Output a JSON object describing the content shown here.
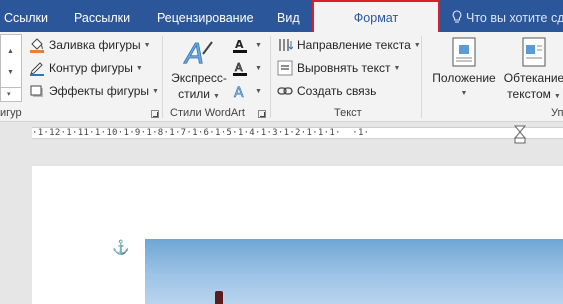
{
  "tabs": [
    {
      "label": "Ссылки"
    },
    {
      "label": "Рассылки"
    },
    {
      "label": "Рецензирование"
    },
    {
      "label": "Вид"
    },
    {
      "label": "Формат",
      "active": true
    }
  ],
  "tell_me": {
    "placeholder": "Что вы хотите сде"
  },
  "ribbon": {
    "shape_styles": {
      "fill": "Заливка фигуры",
      "outline": "Контур фигуры",
      "effects": "Эффекты фигуры",
      "label": "игур"
    },
    "wordart": {
      "express_line1": "Экспресс-",
      "express_line2": "стили",
      "label": "Стили WordArt"
    },
    "text": {
      "direction": "Направление текста",
      "align": "Выровнять текст",
      "link": "Создать связь",
      "label": "Текст"
    },
    "arrange": {
      "position": "Положение",
      "wrap_line1": "Обтекание",
      "wrap_line2": "текстом",
      "label": "Уп"
    }
  },
  "ruler": {
    "text": "·1·12·1·11·1·10·1·9·1·8·1·7·1·6·1·5·1·4·1·3·1·2·1·1·1·  ·1·"
  },
  "colors": {
    "tab_bar": "#2b579a",
    "active_outline": "#d6202b",
    "ribbon": "#f3f3f3"
  }
}
